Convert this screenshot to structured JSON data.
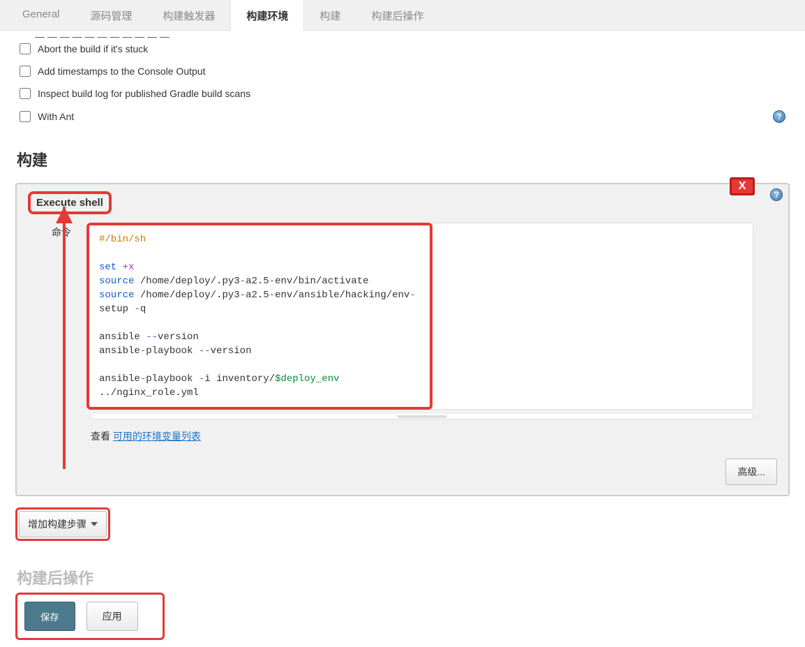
{
  "tabs": {
    "general": "General",
    "scm": "源码管理",
    "triggers": "构建触发器",
    "env": "构建环境",
    "build": "构建",
    "post": "构建后操作"
  },
  "env_opts": {
    "abort": "Abort the build if it's stuck",
    "timestamps": "Add timestamps to the Console Output",
    "gradle": "Inspect build log for published Gradle build scans",
    "ant": "With Ant"
  },
  "section_build": "构建",
  "step": {
    "title": "Execute shell",
    "cmd_label": "命令",
    "delete": "X",
    "shell": {
      "shebang": "#/bin/sh",
      "set": "set",
      "set_arg": "+x",
      "src": "source",
      "env_base": "/home/deploy/.py3",
      "env_suffix": "env",
      "a25": "a2.5",
      "bin_activate": "/bin/activate",
      "ans_hack": "/ansible/hacking/env",
      "setup": "setup",
      "q": "q",
      "ansible": "ansible",
      "version": "version",
      "playbook": "playbook",
      "i": "i",
      "inv": "inventory/",
      "deploy_env": "$deploy_env",
      "yml": "./nginx_role.yml",
      "dashdash": "--",
      "dash": "-"
    },
    "see": "查看 ",
    "envlink": "可用的环境变量列表",
    "advanced": "高级..."
  },
  "add_step": "增加构建步骤",
  "post_title": "构建后操作",
  "footer": {
    "save": "保存",
    "apply": "应用"
  },
  "help_glyph": "?"
}
